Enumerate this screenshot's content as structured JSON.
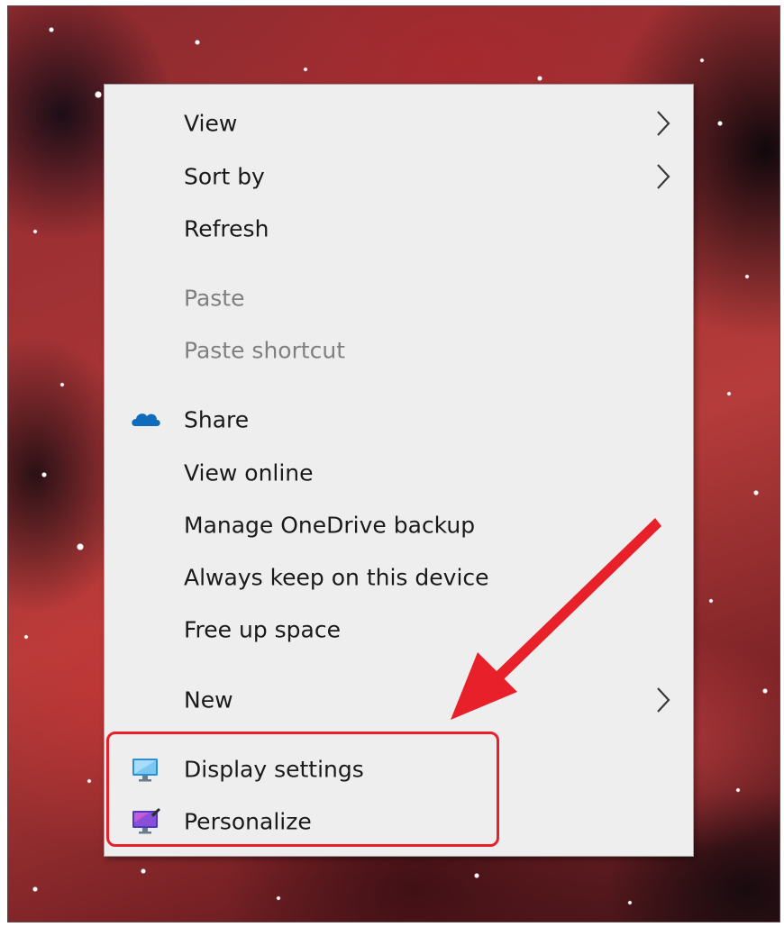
{
  "context_menu": {
    "items": [
      {
        "label": "View",
        "submenu": true,
        "disabled": false
      },
      {
        "label": "Sort by",
        "submenu": true,
        "disabled": false
      },
      {
        "label": "Refresh",
        "submenu": false,
        "disabled": false
      },
      {
        "label": "Paste",
        "submenu": false,
        "disabled": true
      },
      {
        "label": "Paste shortcut",
        "submenu": false,
        "disabled": true
      },
      {
        "label": "Share",
        "submenu": false,
        "disabled": false,
        "icon": "onedrive-cloud-icon"
      },
      {
        "label": "View online",
        "submenu": false,
        "disabled": false
      },
      {
        "label": "Manage OneDrive backup",
        "submenu": false,
        "disabled": false
      },
      {
        "label": "Always keep on this device",
        "submenu": false,
        "disabled": false
      },
      {
        "label": "Free up space",
        "submenu": false,
        "disabled": false
      },
      {
        "label": "New",
        "submenu": true,
        "disabled": false
      },
      {
        "label": "Display settings",
        "submenu": false,
        "disabled": false,
        "icon": "display-monitor-icon"
      },
      {
        "label": "Personalize",
        "submenu": false,
        "disabled": false,
        "icon": "personalize-monitor-icon"
      }
    ]
  },
  "annotation": {
    "color": "#e8202a",
    "highlighted_items": [
      "Display settings",
      "Personalize"
    ]
  },
  "colors": {
    "menu_background": "#eeeeee",
    "text": "#1a1a1a",
    "disabled_text": "#808080",
    "onedrive_blue": "#0f6cbd"
  }
}
